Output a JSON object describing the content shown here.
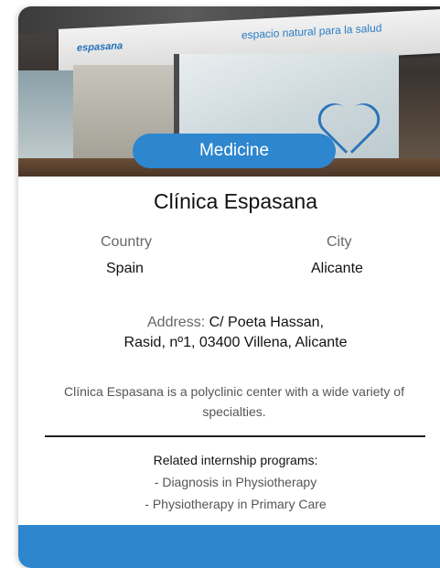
{
  "card": {
    "category_badge": "Medicine",
    "hero": {
      "sign_logo": "espasana",
      "sign_text": "espacio natural para la salud"
    },
    "title": "Clínica Espasana",
    "country": {
      "label": "Country",
      "value": "Spain"
    },
    "city": {
      "label": "City",
      "value": "Alicante"
    },
    "address": {
      "label": "Address:",
      "line1": "C/ Poeta Hassan,",
      "line2": "Rasid, nº1, 03400 Villena, Alicante"
    },
    "description": "Clínica Espasana is a polyclinic center with a wide variety of specialties.",
    "related_programs": {
      "title": "Related internship programs:",
      "items": [
        "- Diagnosis in Physiotherapy",
        "- Physiotherapy in Primary Care"
      ]
    }
  },
  "colors": {
    "accent": "#2d86ce",
    "text": "#111111",
    "muted": "#666666"
  }
}
